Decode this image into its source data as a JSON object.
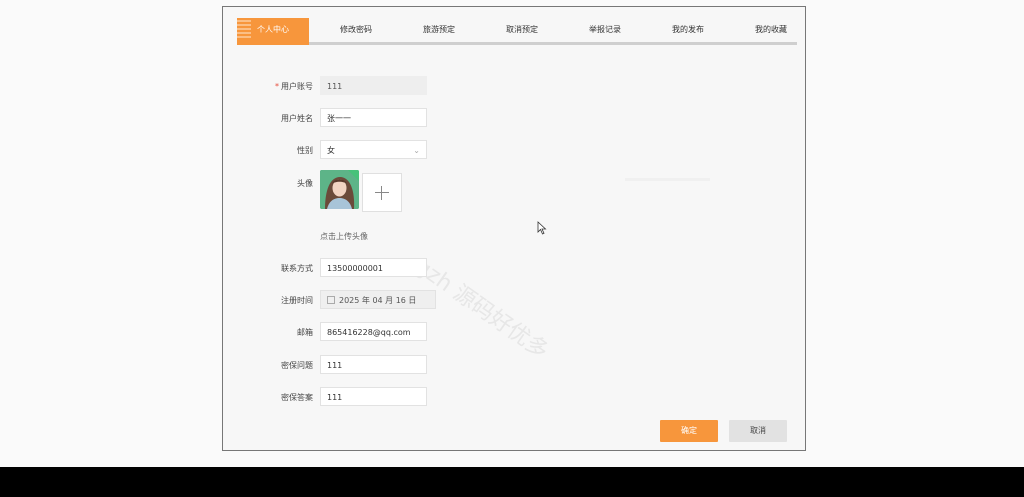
{
  "tabs": [
    {
      "label": "个人中心",
      "active": true
    },
    {
      "label": "修改密码",
      "active": false
    },
    {
      "label": "旅游预定",
      "active": false
    },
    {
      "label": "取消预定",
      "active": false
    },
    {
      "label": "举报记录",
      "active": false
    },
    {
      "label": "我的发布",
      "active": false
    },
    {
      "label": "我的收藏",
      "active": false
    }
  ],
  "form": {
    "account": {
      "label": "用户账号",
      "required_mark": "*",
      "value": "111"
    },
    "name": {
      "label": "用户姓名",
      "value": "张一一"
    },
    "gender": {
      "label": "性别",
      "value": "女"
    },
    "avatar": {
      "label": "头像",
      "hint": "点击上传头像"
    },
    "phone": {
      "label": "联系方式",
      "value": "13500000001"
    },
    "register_time": {
      "label": "注册时间",
      "value": "2025 年 04 月 16 日"
    },
    "email": {
      "label": "邮箱",
      "value": "865416228@qq.com"
    },
    "security_question": {
      "label": "密保问题",
      "value": "111"
    },
    "security_answer": {
      "label": "密保答案",
      "value": "111"
    }
  },
  "buttons": {
    "confirm": "确定",
    "cancel": "取消"
  },
  "watermark": "gzh 源码好优多",
  "colors": {
    "accent": "#f7963c",
    "required": "#e64c3c",
    "disabled_bg": "#eeeeee"
  }
}
